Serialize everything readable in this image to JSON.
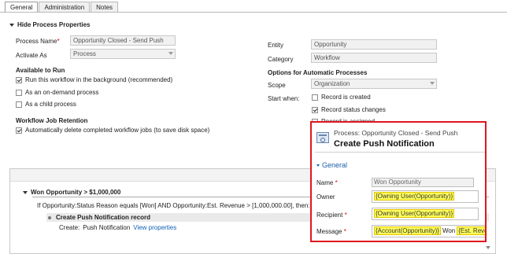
{
  "tabs": [
    "General",
    "Administration",
    "Notes"
  ],
  "section": {
    "title": "Hide Process Properties"
  },
  "left": {
    "process_name_label": "Process Name",
    "process_name_value": "Opportunity Closed - Send Push",
    "activate_as_label": "Activate As",
    "activate_as_value": "Process",
    "available_to_run_title": "Available to Run",
    "opt_background": "Run this workflow in the background (recommended)",
    "opt_on_demand": "As an on-demand process",
    "opt_child": "As a child process",
    "retention_title": "Workflow Job Retention",
    "opt_auto_delete": "Automatically delete completed workflow jobs (to save disk space)"
  },
  "right": {
    "entity_label": "Entity",
    "entity_value": "Opportunity",
    "category_label": "Category",
    "category_value": "Workflow",
    "auto_title": "Options for Automatic Processes",
    "scope_label": "Scope",
    "scope_value": "Organization",
    "start_when_label": "Start when:",
    "opt_record_created": "Record is created",
    "opt_status_changes": "Record status changes",
    "opt_assigned": "Record is assigned"
  },
  "steps": {
    "condition_title": "Won Opportunity > $1,000,000",
    "if_text": "If Opportunity:Status Reason equals [Won] AND Opportunity:Est. Revenue > [1,000,000.00], then:",
    "step_label": "Create Push Notification record",
    "create_prefix": "Create:",
    "create_entity": "Push Notification",
    "view_link": "View properties"
  },
  "popup": {
    "subtitle": "Process: Opportunity Closed - Send Push",
    "title": "Create Push Notification",
    "section": "General",
    "name_label": "Name",
    "name_value": "Won Opportunity",
    "owner_label": "Owner",
    "owner_value": "{Owning User(Opportunity)}",
    "recipient_label": "Recipient",
    "recipient_value": "{Owning User(Opportunity)}",
    "message_label": "Message",
    "message_token1": "{Account(Opportunity)}",
    "message_text": "Won",
    "message_token2": "{Est. Reve"
  },
  "colors": {
    "highlight": "#ffff5a",
    "popup_border": "#e0161d",
    "link": "#1160b7",
    "required": "#dd0000"
  }
}
